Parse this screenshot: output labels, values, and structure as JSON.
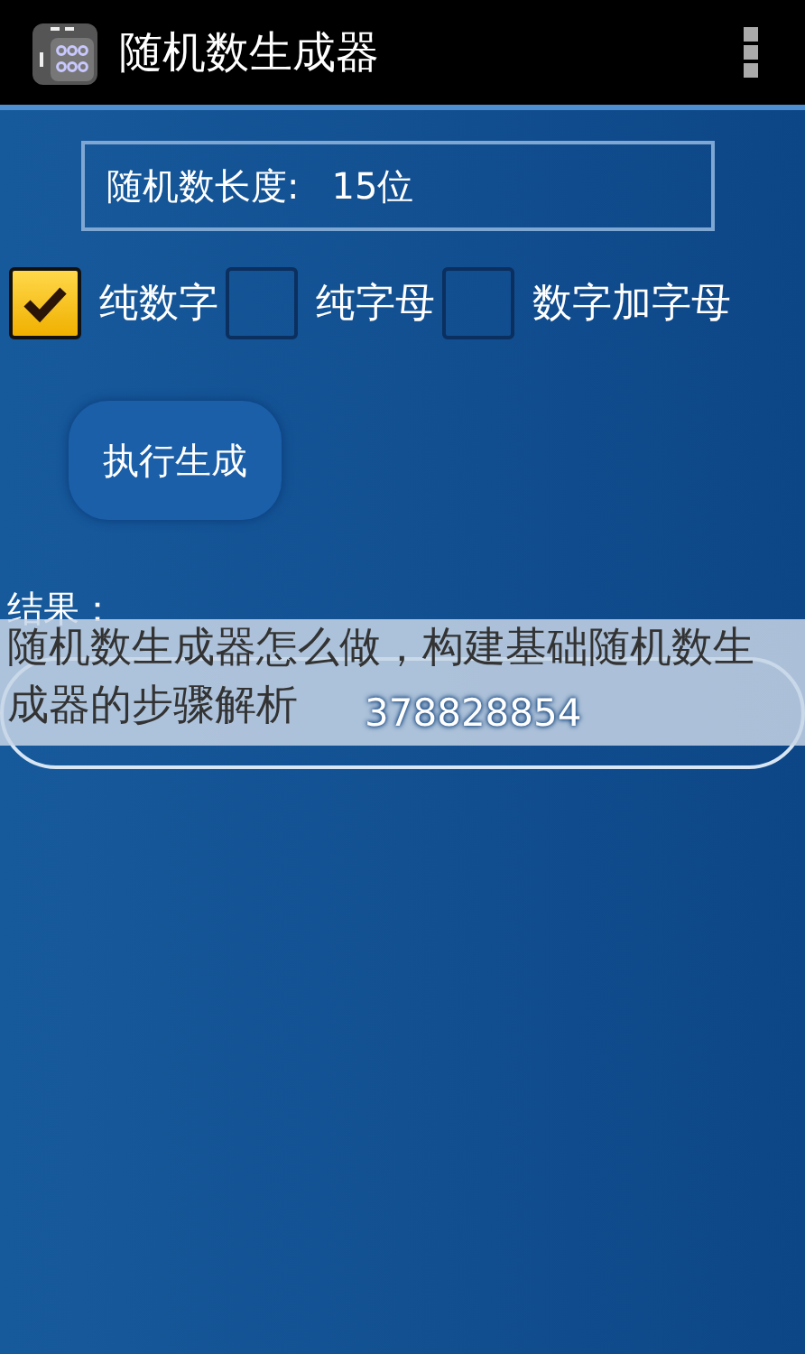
{
  "app_bar": {
    "title": "随机数生成器"
  },
  "length_field": {
    "label": "随机数长度:",
    "value": "15位"
  },
  "options": [
    {
      "label": "纯数字",
      "checked": true
    },
    {
      "label": "纯字母",
      "checked": false
    },
    {
      "label": "数字加字母",
      "checked": false
    }
  ],
  "generate_button": "执行生成",
  "result": {
    "label": "结果：",
    "value": "378828854"
  },
  "caption_overlay": "随机数生成器怎么做，构建基础随机数生成器的步骤解析"
}
